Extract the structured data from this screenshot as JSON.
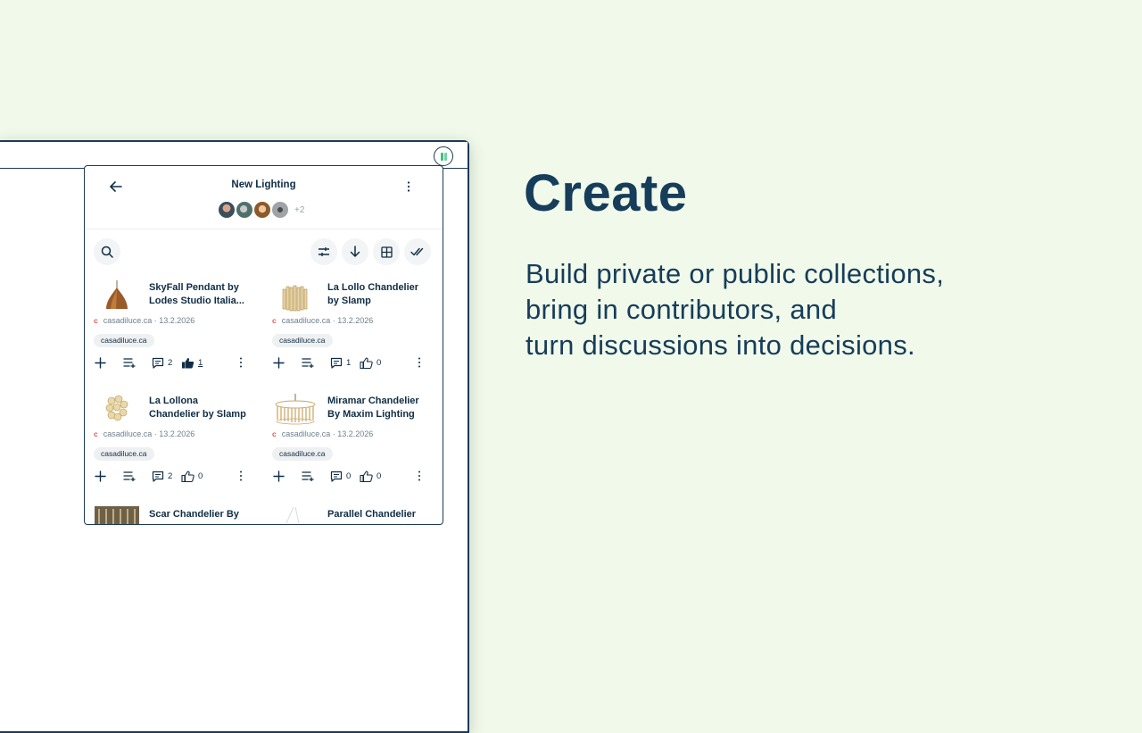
{
  "hero": {
    "title": "Create",
    "lines": [
      "Build private or public collections,",
      "bring in contributors, and",
      "turn discussions into decisions."
    ]
  },
  "panel": {
    "title": "New Lighting",
    "extra_contributors": "+2",
    "toolbar": {
      "icons": [
        "search-icon",
        "filter-icon",
        "sort-down-icon",
        "grid-view-icon",
        "check-all-icon"
      ]
    },
    "items": [
      {
        "title": "SkyFall Pendant by Lodes Studio Italia...",
        "source_initial": "c",
        "source": "casadiluce.ca · 13.2.2026",
        "tag": "casadiluce.ca",
        "comments": "2",
        "likes": "1",
        "liked": true
      },
      {
        "title": "La Lollo Chandelier by Slamp",
        "source_initial": "c",
        "source": "casadiluce.ca · 13.2.2026",
        "tag": "casadiluce.ca",
        "comments": "1",
        "likes": "0",
        "liked": false
      },
      {
        "title": "La Lollona Chandelier by Slamp",
        "source_initial": "c",
        "source": "casadiluce.ca · 13.2.2026",
        "tag": "casadiluce.ca",
        "comments": "2",
        "likes": "0",
        "liked": false
      },
      {
        "title": "Miramar Chandelier By Maxim Lighting",
        "source_initial": "c",
        "source": "casadiluce.ca · 13.2.2026",
        "tag": "casadiluce.ca",
        "comments": "0",
        "likes": "0",
        "liked": false
      },
      {
        "title": "Scar Chandelier By",
        "source_initial": "",
        "source": "",
        "tag": "",
        "comments": "",
        "likes": "",
        "liked": false
      },
      {
        "title": "Parallel Chandelier",
        "source_initial": "",
        "source": "",
        "tag": "",
        "comments": "",
        "likes": "",
        "liked": false
      }
    ]
  },
  "colors": {
    "background": "#f1f9ea",
    "navy": "#163d5a",
    "source_red": "#e0574f",
    "extension_green": "#3fbf7f"
  }
}
